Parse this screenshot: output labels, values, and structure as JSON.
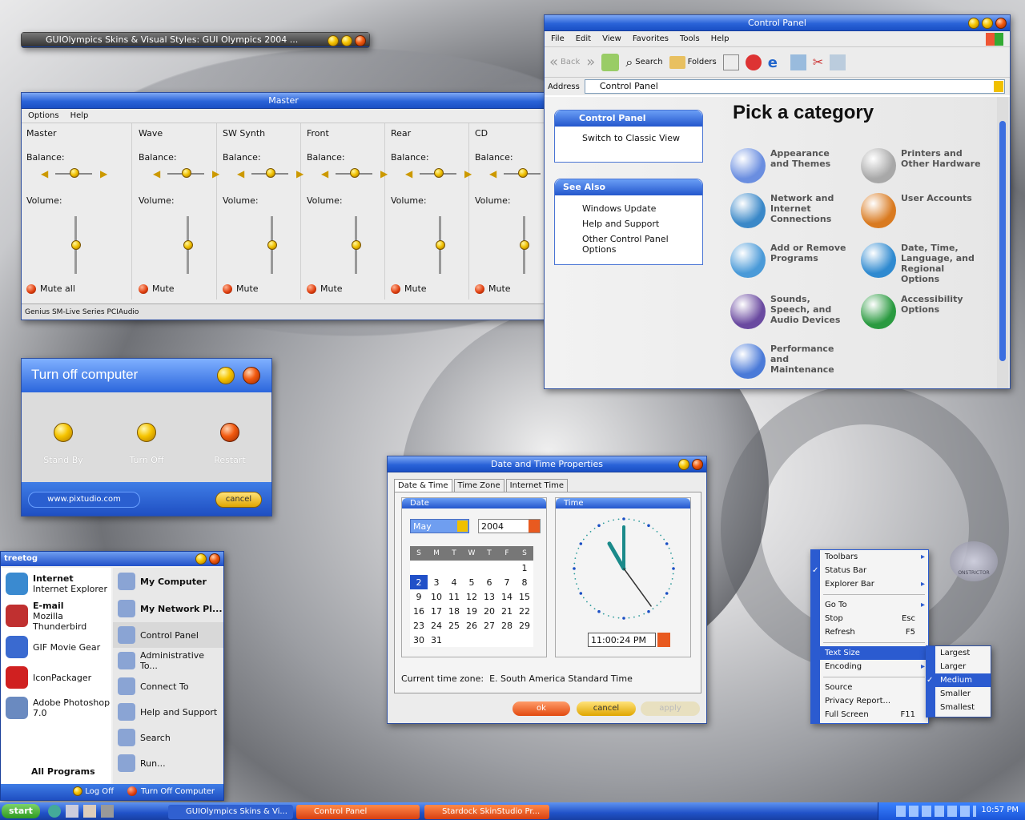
{
  "gui_olympics_window": {
    "title": "GUIOlympics Skins & Visual Styles: GUI Olympics 2004 ..."
  },
  "mixer": {
    "title": "Master",
    "menu": [
      "Options",
      "Help"
    ],
    "channels": [
      {
        "name": "Master",
        "mute": "Mute all"
      },
      {
        "name": "Wave",
        "mute": "Mute"
      },
      {
        "name": "SW Synth",
        "mute": "Mute"
      },
      {
        "name": "Front",
        "mute": "Mute"
      },
      {
        "name": "Rear",
        "mute": "Mute"
      },
      {
        "name": "CD",
        "mute": "Mute"
      }
    ],
    "balance_label": "Balance:",
    "volume_label": "Volume:",
    "status": "Genius SM-Live Series PCIAudio"
  },
  "turnoff": {
    "title": "Turn off computer",
    "options": [
      "Stand By",
      "Turn Off",
      "Restart"
    ],
    "link": "www.pixtudio.com",
    "cancel": "cancel"
  },
  "control_panel": {
    "title": "Control Panel",
    "menu": [
      "File",
      "Edit",
      "View",
      "Favorites",
      "Tools",
      "Help"
    ],
    "toolbar": {
      "back": "Back",
      "search": "Search",
      "folders": "Folders"
    },
    "address_label": "Address",
    "address_value": "Control Panel",
    "sidebar_panel_title": "Control Panel",
    "switch_classic": "Switch to Classic View",
    "see_also_title": "See Also",
    "see_also": [
      "Windows Update",
      "Help and Support",
      "Other Control Panel Options"
    ],
    "heading": "Pick a category",
    "categories": [
      "Appearance and Themes",
      "Printers and Other Hardware",
      "Network and Internet Connections",
      "User Accounts",
      "Add or Remove Programs",
      "Date, Time, Language, and Regional Options",
      "Sounds, Speech, and Audio Devices",
      "Accessibility Options",
      "Performance and Maintenance"
    ]
  },
  "datetime": {
    "title": "Date and Time Properties",
    "tabs": [
      "Date & Time",
      "Time Zone",
      "Internet Time"
    ],
    "date_group": "Date",
    "time_group": "Time",
    "month": "May",
    "year": "2004",
    "weekdays": [
      "S",
      "M",
      "T",
      "W",
      "T",
      "F",
      "S"
    ],
    "selected_day": "2",
    "days_in_month": 31,
    "first_weekday": 6,
    "time_value": "11:00:24 PM",
    "clock_hour": 11,
    "clock_minute": 0,
    "clock_second": 24,
    "timezone_label": "Current time zone:",
    "timezone_value": "E. South America Standard Time",
    "ok": "ok",
    "cancel": "cancel",
    "apply": "apply"
  },
  "start_menu": {
    "user": "treetog",
    "left": [
      {
        "title": "Internet",
        "sub": "Internet Explorer"
      },
      {
        "title": "E-mail",
        "sub": "Mozilla Thunderbird"
      },
      {
        "title": "GIF Movie Gear",
        "sub": ""
      },
      {
        "title": "IconPackager",
        "sub": ""
      },
      {
        "title": "Adobe Photoshop 7.0",
        "sub": ""
      }
    ],
    "all_programs": "All Programs",
    "right": [
      "My Computer",
      "My Network Pl...",
      "Control Panel",
      "Administrative To...",
      "Connect To",
      "Help and Support",
      "Search",
      "Run..."
    ],
    "log_off": "Log Off",
    "turn_off": "Turn Off Computer"
  },
  "context_menu": {
    "items": [
      {
        "label": "Toolbars",
        "arrow": true
      },
      {
        "label": "Status Bar",
        "check": true
      },
      {
        "label": "Explorer Bar",
        "arrow": true
      },
      {
        "sep": true
      },
      {
        "label": "Go To",
        "arrow": true
      },
      {
        "label": "Stop",
        "shortcut": "Esc"
      },
      {
        "label": "Refresh",
        "shortcut": "F5"
      },
      {
        "sep": true
      },
      {
        "label": "Text Size",
        "arrow": true,
        "highlight": true
      },
      {
        "label": "Encoding",
        "arrow": true
      },
      {
        "sep": true
      },
      {
        "label": "Source"
      },
      {
        "label": "Privacy Report..."
      },
      {
        "label": "Full Screen",
        "shortcut": "F11"
      }
    ],
    "submenu": [
      "Largest",
      "Larger",
      "Medium",
      "Smaller",
      "Smallest"
    ],
    "submenu_selected": "Medium"
  },
  "logo_text": "ONSTRICTOR",
  "taskbar": {
    "start": "start",
    "tasks": [
      "GUIOlympics Skins & Vi...",
      "Control Panel",
      "Stardock SkinStudio Pr..."
    ],
    "clock": "10:57 PM"
  }
}
